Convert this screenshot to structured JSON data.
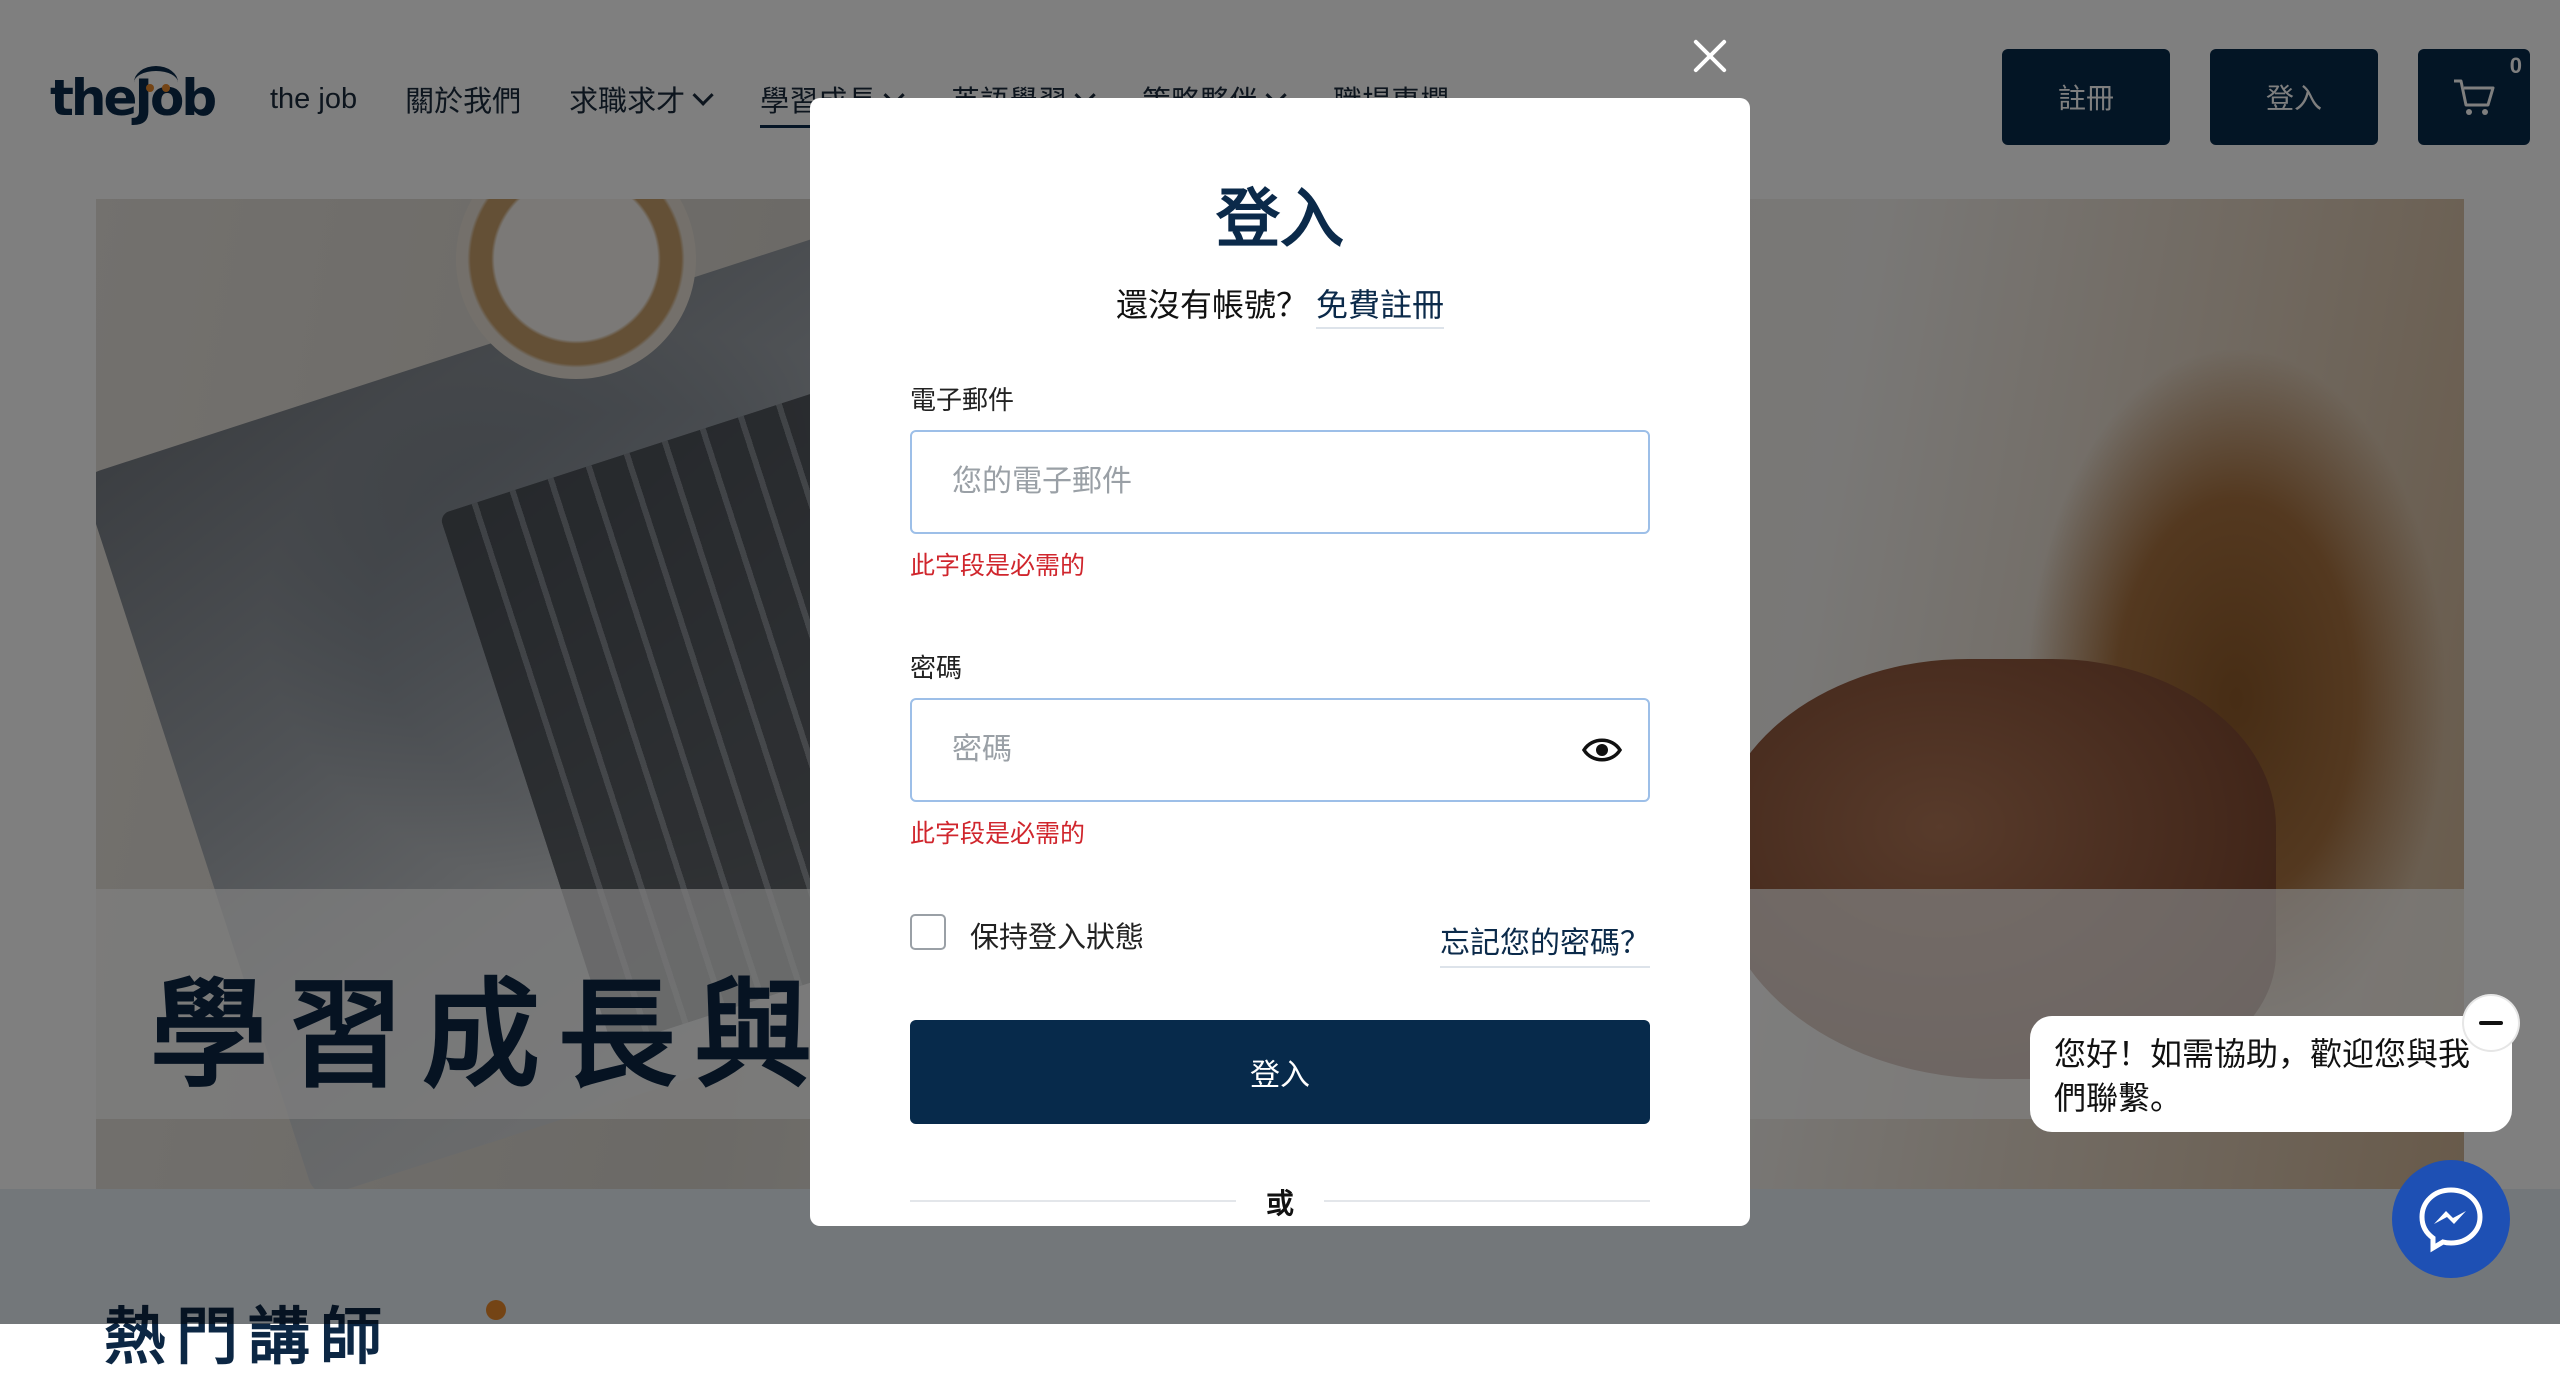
{
  "header": {
    "logo_text": "theJob",
    "nav": [
      {
        "label": "the job",
        "has_dropdown": false,
        "active": false
      },
      {
        "label": "關於我們",
        "has_dropdown": false,
        "active": false
      },
      {
        "label": "求職求才",
        "has_dropdown": true,
        "active": false
      },
      {
        "label": "學習成長",
        "has_dropdown": true,
        "active": true
      },
      {
        "label": "英語學習",
        "has_dropdown": true,
        "active": false
      },
      {
        "label": "策略夥伴",
        "has_dropdown": true,
        "active": false
      },
      {
        "label": "職場專欄",
        "has_dropdown": false,
        "active": false
      }
    ],
    "register_label": "註冊",
    "login_label": "登入",
    "cart_count": "0"
  },
  "hero": {
    "title": "學習成長與才"
  },
  "section": {
    "title": "熱門講師"
  },
  "modal": {
    "title": "登入",
    "no_account_text": "還沒有帳號？",
    "register_link": "免費註冊",
    "email_label": "電子郵件",
    "email_placeholder": "您的電子郵件",
    "email_value": "",
    "email_error": "此字段是必需的",
    "password_label": "密碼",
    "password_placeholder": "密碼",
    "password_value": "",
    "password_error": "此字段是必需的",
    "remember_label": "保持登入狀態",
    "remember_checked": false,
    "forgot_link": "忘記您的密碼？",
    "submit_label": "登入",
    "or_text": "或"
  },
  "chat": {
    "greeting": "您好！如需協助，歡迎您與我們聯繫。"
  },
  "colors": {
    "primary": "#072a4b",
    "accent": "#e8892b",
    "error": "#d0262d",
    "messenger": "#1e50b4",
    "overlay": "rgba(0,0,0,0.5)"
  },
  "icons": [
    "close-icon",
    "chevron-down-icon",
    "cart-icon",
    "eye-icon",
    "messenger-icon",
    "minimize-icon"
  ]
}
